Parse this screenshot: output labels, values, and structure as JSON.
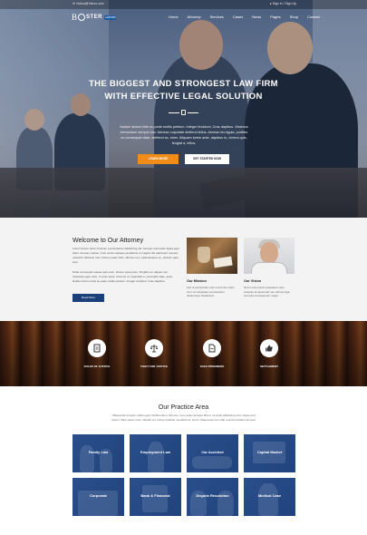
{
  "topbar": {
    "email": "✉ Yahoo@Yahoo.com",
    "signin": "● Sign In / Sign Up"
  },
  "logo": {
    "letter": "B",
    "name": "STER",
    "tag": "LAWFIRM"
  },
  "nav": [
    "Home",
    "Attorney",
    "Services",
    "Cases",
    "News",
    "Pages",
    "Shop",
    "Contact"
  ],
  "hero": {
    "headline_line1": "THE BIGGEST AND STRONGEST LAW FIRM",
    "headline_line2": "WITH EFFECTIVE LEGAL SOLUTION",
    "subtext": "Nullam dictum felis eu pede mollis pretium. Integer tincidunt. Cras dapibus. Vivamus elementum semper nisi. Aenean vulputate eleifend tellus. Aenean leo ligula, porttitor eu consequat vitae, eleifend ac, enim. Aliquam lorem ante, dapibus in, viverra quis, feugiat a, tellus.",
    "learn_more": "LEARN MORE",
    "get_quote": "GET STARTED NOW"
  },
  "welcome": {
    "title": "Welcome to Our Attorney",
    "text1": "Lorem ipsum dolor sit amet, consectetuer adipiscing elit. Aenean commodo ligula eget dolor. Aenean massa. Cum sociis natoque penatibus et magnis dis parturient montes, nascetur ridiculus mus. Donec quam felis, ultricies nec, pellentesque eu, pretium quis, sem.",
    "text2": "Nulla consequat massa quis enim. Donec pede justo, fringilla vel, aliquet nec, vulputate eget, arcu. In enim justo, rhoncus ut, imperdiet a, venenatis vitae, justo. Nullam dictum felis eu pede mollis pretium. Integer tincidunt. Cras dapibus.",
    "read_more": "Read More",
    "mission": {
      "title": "Our Mission",
      "text": "Sed ut perspiciatis unde omnis iste natus error sit voluptatem accusantium doloremque laudantium."
    },
    "vision": {
      "title": "Our Vision",
      "text": "Nemo enim ipsam voluptatem quia voluptas sit aspernatur aut odit aut fugit, sed quia consequuntur magni."
    }
  },
  "features": [
    {
      "label": "RULES OF JUSTICE",
      "icon": "document-icon"
    },
    {
      "label": "FIGHT FOR JUSTICE",
      "icon": "scales-icon"
    },
    {
      "label": "SAFE PRISONERS",
      "icon": "file-icon"
    },
    {
      "label": "SETTLEMENT",
      "icon": "thumbs-up-icon"
    }
  ],
  "practice": {
    "title": "Our Practice Area",
    "text": "Maecenas tempus, tellus eget condimentum rhoncus, sem quam semper libero, sit amet adipiscing sem neque sed ipsum. Nam quam nunc, blandit vel, luctus pulvinar, hendrerit id, lorem. Maecenas nec odio et ante tincidunt tempus.",
    "areas": [
      "Family Law",
      "Employment Law",
      "Car Accident",
      "Capital Market",
      "Corporate",
      "Bank & Financial",
      "Dispute Resolution",
      "Medical Case"
    ]
  },
  "colors": {
    "accent_orange": "#f28c18",
    "navy": "#1b3f78",
    "tile_blue": "#2b4f86"
  }
}
